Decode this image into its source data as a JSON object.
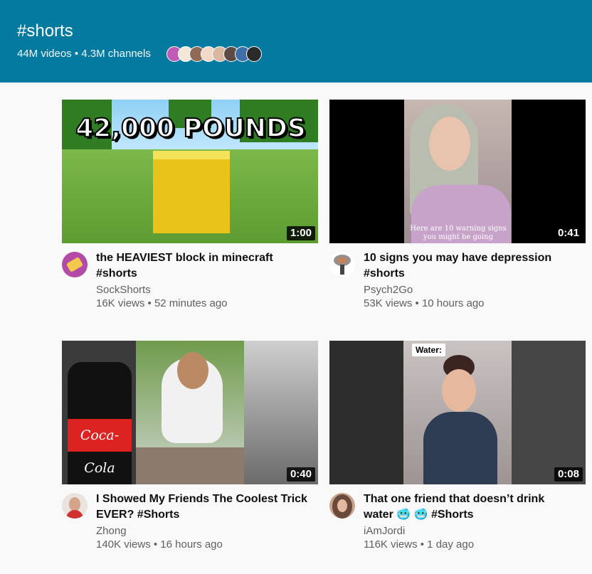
{
  "header": {
    "hashtag": "#shorts",
    "stats": "44M videos • 4.3M channels"
  },
  "videos": [
    {
      "title": "the HEAVIEST block in minecraft #shorts",
      "channel": "SockShorts",
      "meta": "16K views • 52 minutes ago",
      "duration": "1:00",
      "thumb_text": "42,000 POUNDS"
    },
    {
      "title": "10 signs you may have depression #shorts",
      "channel": "Psych2Go",
      "meta": "53K views • 10 hours ago",
      "duration": "0:41",
      "caption": "Here are 10 warning signs you might be going"
    },
    {
      "title": "I Showed My Friends The Coolest Trick EVER? #Shorts",
      "channel": "Zhong",
      "meta": "140K views • 16 hours ago",
      "duration": "0:40",
      "brand": "Coca-Cola"
    },
    {
      "title": "That one friend that doesn’t drink water 🥶 🥶 #Shorts",
      "channel": "iAmJordi",
      "meta": "116K views • 1 day ago",
      "duration": "0:08",
      "water_label": "Water:"
    }
  ],
  "colors": {
    "header_bg": "#047aa0",
    "page_bg": "#f9f9f9"
  }
}
